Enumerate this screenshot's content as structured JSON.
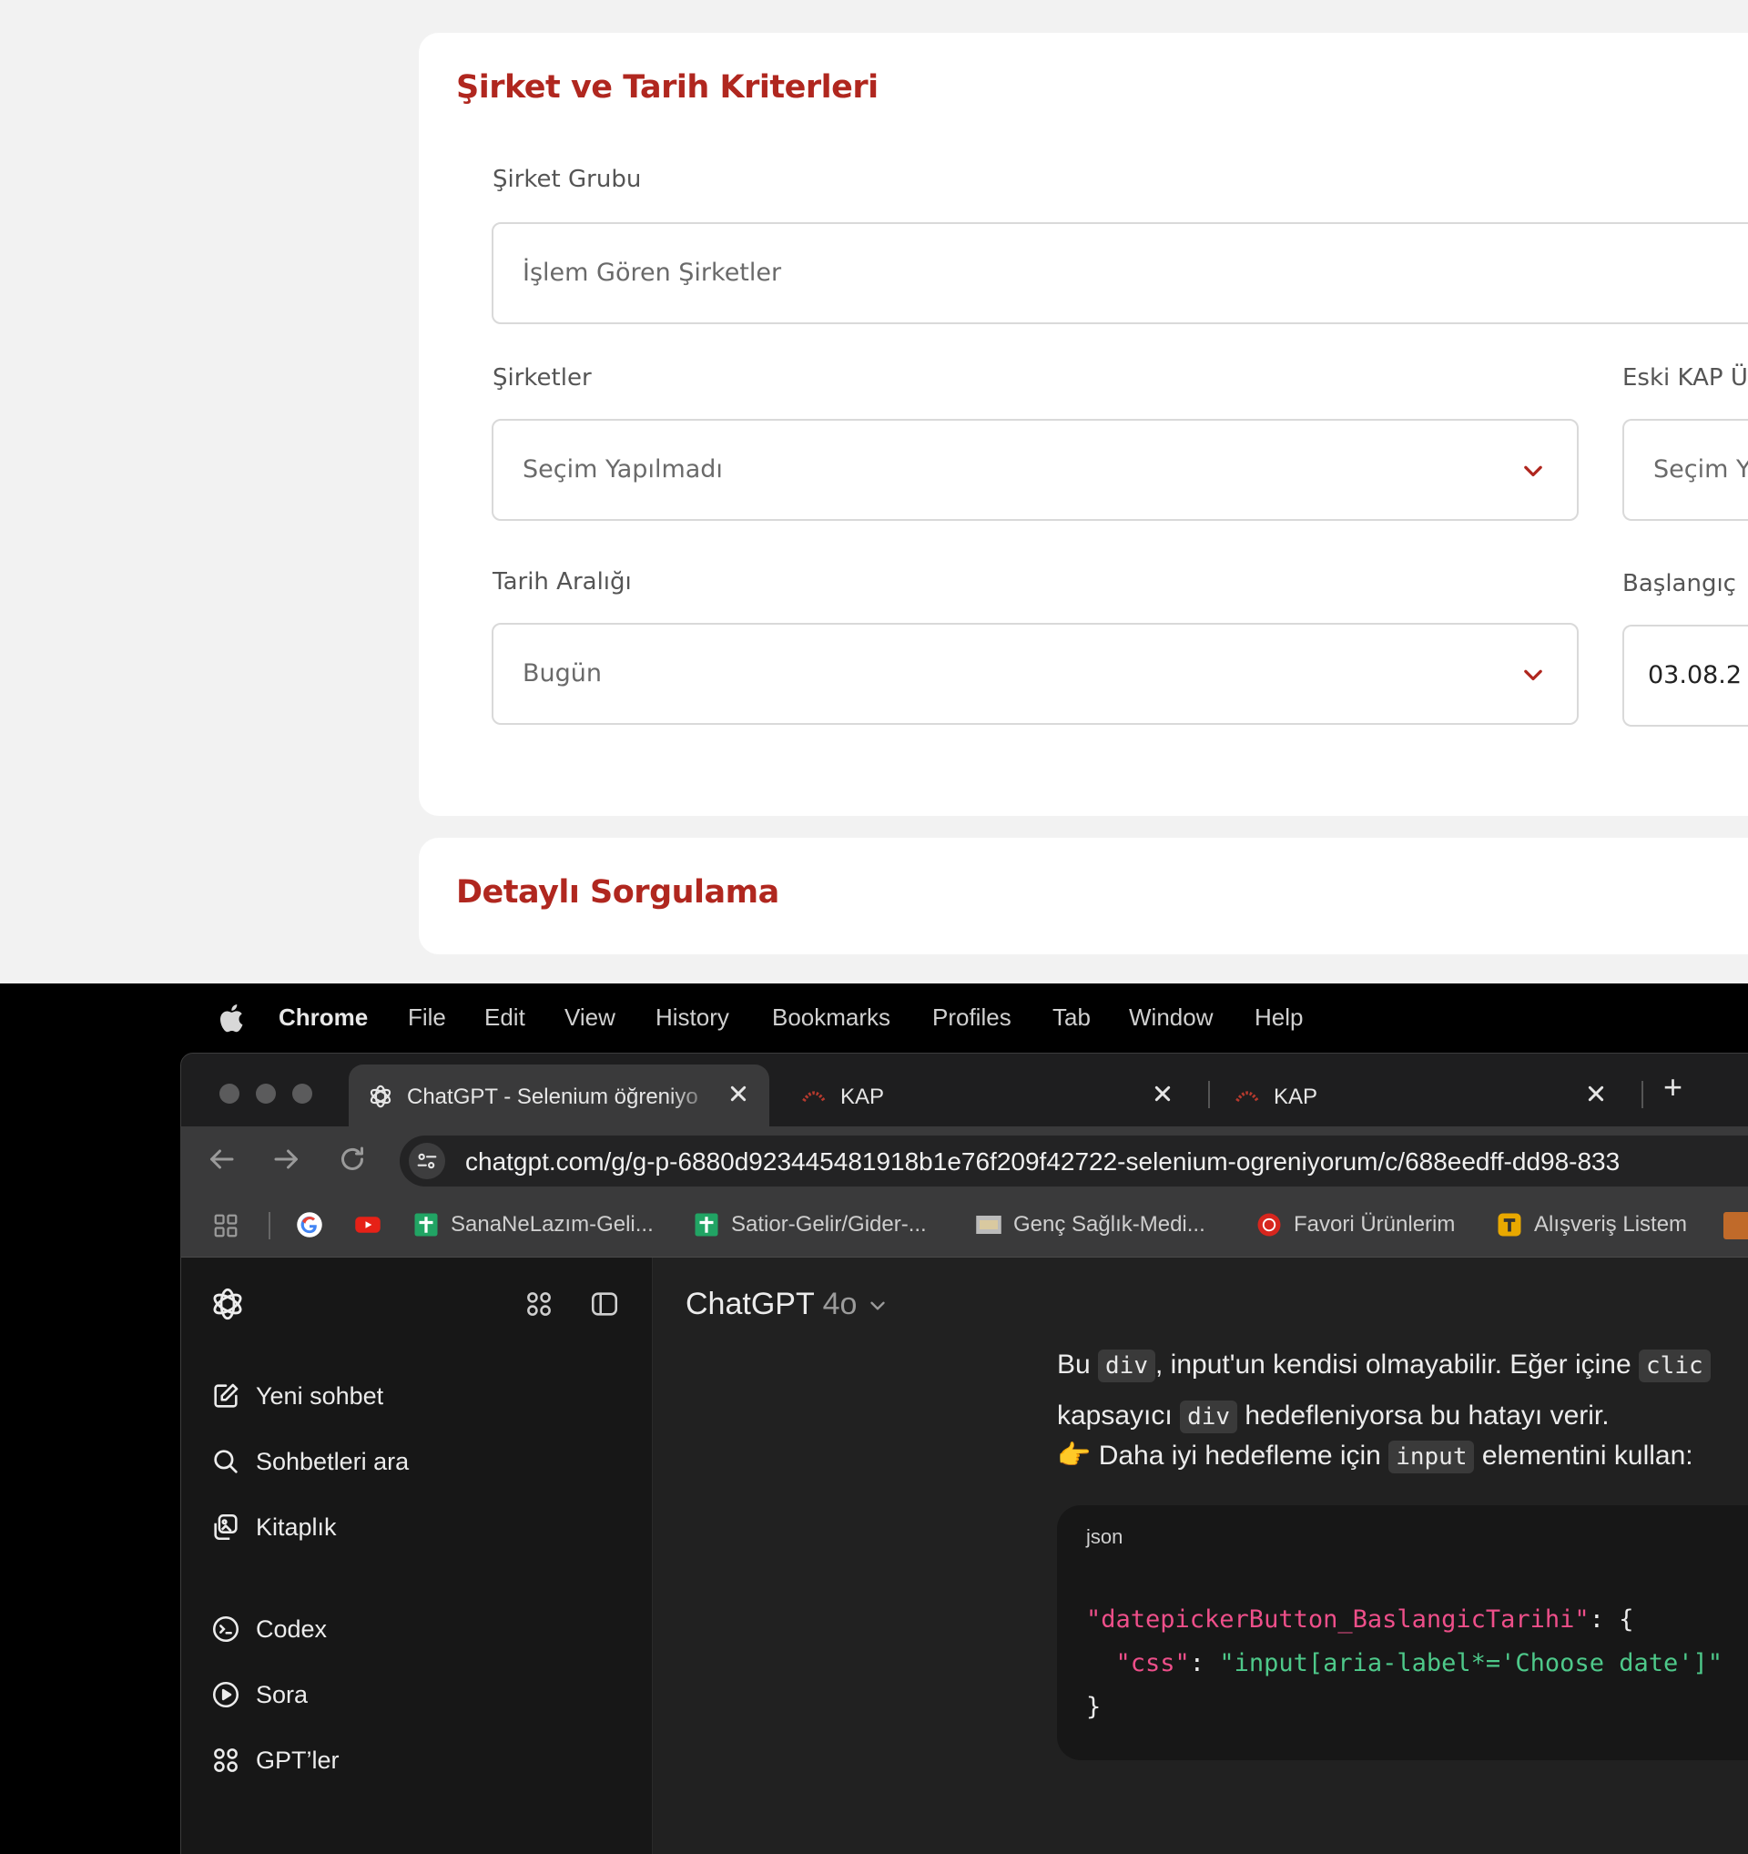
{
  "kap_form": {
    "section1_title": "Şirket ve Tarih Kriterleri",
    "sirket_grubu_label": "Şirket Grubu",
    "sirket_grubu_value": "İşlem Gören Şirketler",
    "sirketler_label": "Şirketler",
    "sirketler_value": "Seçim Yapılmadı",
    "eski_kap_label": "Eski KAP Ü",
    "eski_kap_value": "Seçim Y",
    "tarih_araligi_label": "Tarih Aralığı",
    "tarih_araligi_value": "Bugün",
    "baslangic_label": "Başlangıç",
    "baslangic_value": "03.08.2",
    "section2_title": "Detaylı Sorgulama",
    "accent_color": "#b0271f"
  },
  "mac_menubar": {
    "app": "Chrome",
    "items": [
      "File",
      "Edit",
      "View",
      "History",
      "Bookmarks",
      "Profiles",
      "Tab",
      "Window",
      "Help"
    ]
  },
  "chrome": {
    "tabs": [
      {
        "title": "ChatGPT - Selenium öğreniyo",
        "icon": "openai-icon",
        "active": true
      },
      {
        "title": "KAP",
        "icon": "kap-icon",
        "active": false
      },
      {
        "title": "KAP",
        "icon": "kap-icon",
        "active": false
      }
    ],
    "new_tab_label": "+",
    "url": "chatgpt.com/g/g-p-6880d923445481918b1e76f209f42722-selenium-ogreniyorum/c/688eedff-dd98-833",
    "bookmarks": [
      {
        "label": "",
        "icon": "google-icon"
      },
      {
        "label": "",
        "icon": "youtube-icon"
      },
      {
        "label": "SanaNeLazım-Geli...",
        "icon": "sheets-icon"
      },
      {
        "label": "Satior-Gelir/Gider-...",
        "icon": "sheets-icon"
      },
      {
        "label": "Genç Sağlık-Medi...",
        "icon": "image-icon"
      },
      {
        "label": "Favori Ürünlerim",
        "icon": "red-circle-icon"
      },
      {
        "label": "Alışveriş Listem",
        "icon": "yellow-t-icon"
      }
    ]
  },
  "chatgpt": {
    "sidebar": {
      "items": [
        {
          "label": "Yeni sohbet",
          "icon": "edit-icon"
        },
        {
          "label": "Sohbetleri ara",
          "icon": "search-icon"
        },
        {
          "label": "Kitaplık",
          "icon": "library-icon"
        },
        {
          "label": "Codex",
          "icon": "codex-icon"
        },
        {
          "label": "Sora",
          "icon": "play-icon"
        },
        {
          "label": "GPT’ler",
          "icon": "grid-icon"
        }
      ]
    },
    "model_name": "ChatGPT",
    "model_version": "4o",
    "message": {
      "p1_a": "Bu ",
      "p1_code1": "div",
      "p1_b": ", input'un kendisi olmayabilir. Eğer içine ",
      "p1_code2": "clic",
      "p2_a": "kapsayıcı ",
      "p2_code": "div",
      "p2_b": " hedefleniyorsa bu hatayı verir.",
      "p3_emoji": "👉",
      "p3_a": " Daha iyi hedefleme için ",
      "p3_code": "input",
      "p3_b": " elementini kullan:",
      "code_lang": "json",
      "code_line1_key": "\"datepickerButton_BaslangicTarihi\"",
      "code_line1_rest": ": {",
      "code_line2_key": "\"css\"",
      "code_line2_sep": ": ",
      "code_line2_val": "\"input[aria-label*='Choose date']\"",
      "code_line3": "}"
    }
  }
}
